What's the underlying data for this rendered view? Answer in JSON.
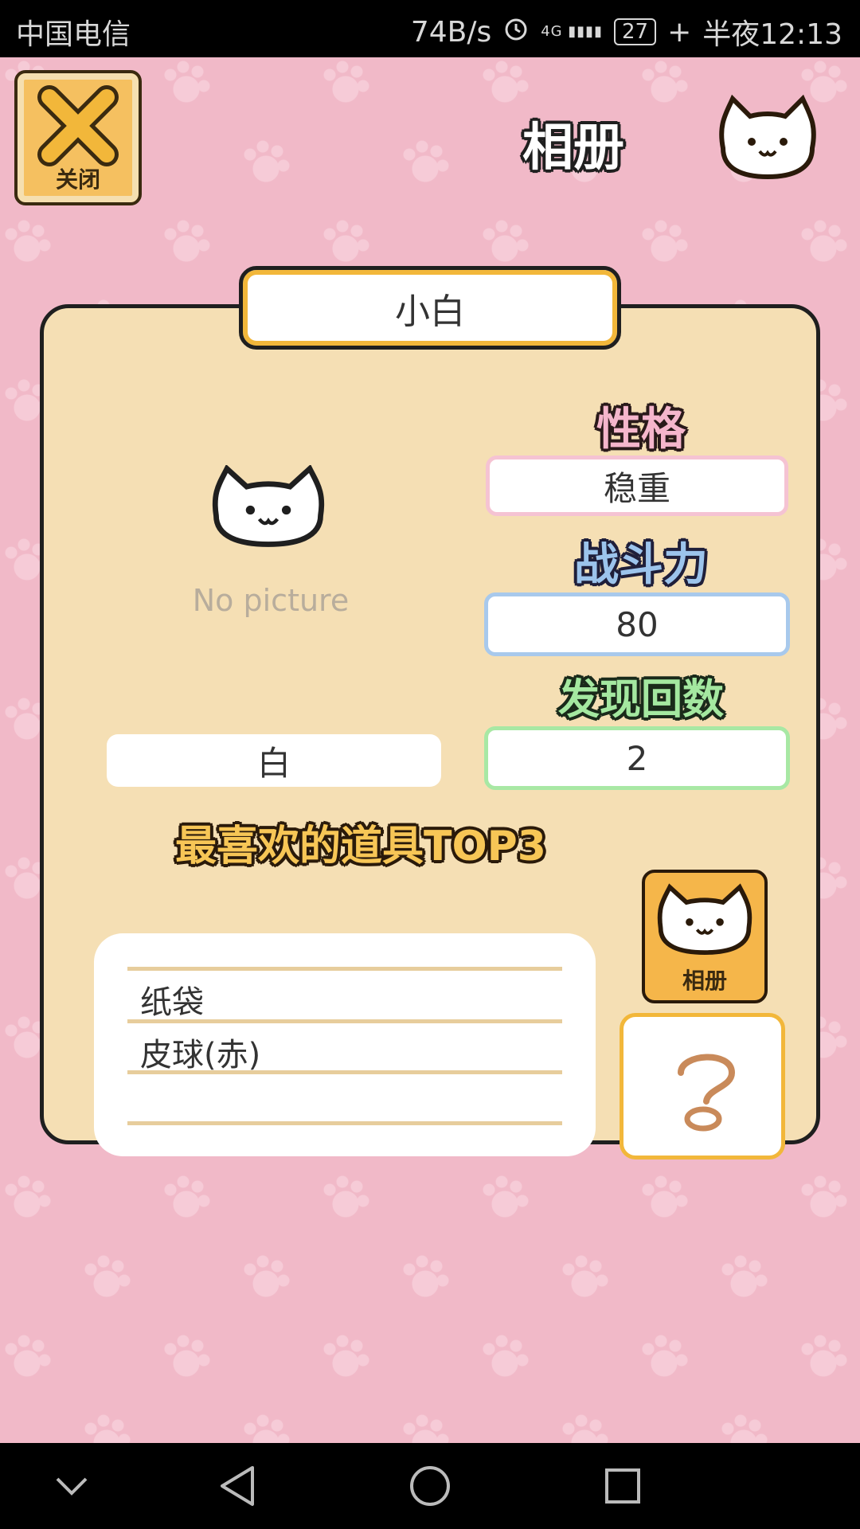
{
  "status_bar": {
    "carrier": "中国电信",
    "net_speed": "74B/s",
    "signal_label": "4G",
    "battery": "27",
    "time": "半夜12:13"
  },
  "header": {
    "close_label": "关闭",
    "title": "相册"
  },
  "card": {
    "cat_name": "小白",
    "no_picture": "No picture",
    "color_value": "白",
    "personality": {
      "label": "性格",
      "value": "稳重"
    },
    "power": {
      "label": "战斗力",
      "value": "80"
    },
    "visits": {
      "label": "发现回数",
      "value": "2"
    },
    "favorites": {
      "title": "最喜欢的道具TOP3",
      "items": [
        "纸袋",
        "皮球(赤)",
        ""
      ]
    },
    "album_label": "相册"
  },
  "icons": {
    "close": "close-x-icon",
    "cat": "cat-face-icon",
    "question": "question-mark-icon",
    "nav_back": "triangle-back-icon",
    "nav_home": "circle-home-icon",
    "nav_recent": "square-recent-icon",
    "nav_down": "chevron-down-icon"
  },
  "colors": {
    "background": "#f1b9c8",
    "card": "#f5dfb4",
    "accent": "#f2b73a",
    "personality": "#f5b6cc",
    "power": "#9cc4ec",
    "visits": "#a4e8a0"
  }
}
